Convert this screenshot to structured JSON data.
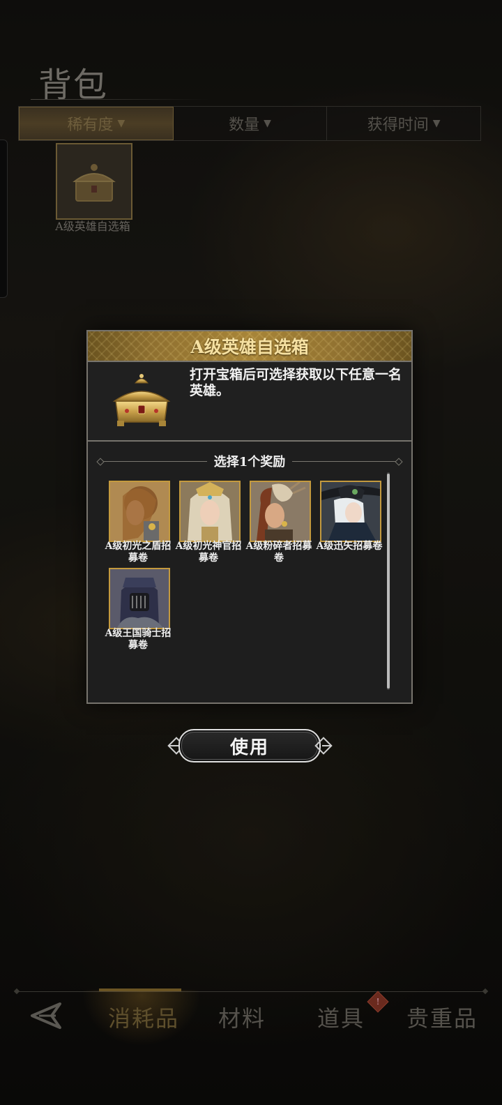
{
  "background": {
    "page_title": "背包",
    "sort_tabs": [
      {
        "label": "稀有度",
        "arrow": "▼",
        "active": true
      },
      {
        "label": "数量",
        "arrow": "▼",
        "active": false
      },
      {
        "label": "获得时间",
        "arrow": "▼",
        "active": false
      }
    ],
    "items": [
      {
        "label": "A级英雄自选箱",
        "icon": "treasure-chest-icon"
      }
    ]
  },
  "bottom_nav": {
    "back_icon": "back-arrow-icon",
    "tabs": [
      {
        "label": "消耗品",
        "active": true
      },
      {
        "label": "材料",
        "active": false
      },
      {
        "label": "道具",
        "active": false,
        "badge": "!"
      },
      {
        "label": "贵重品",
        "active": false
      }
    ]
  },
  "dialog": {
    "title": "A级英雄自选箱",
    "description": "打开宝箱后可选择获取以下任意一名英雄。",
    "chest_icon": "golden-chest-icon",
    "select_title": "选择1个奖励",
    "rewards": [
      {
        "label": "A级初光之盾招募卷",
        "portrait": "hero-portrait-shield"
      },
      {
        "label": "A级初光神官招募卷",
        "portrait": "hero-portrait-priest"
      },
      {
        "label": "A级粉碎者招募卷",
        "portrait": "hero-portrait-crusher"
      },
      {
        "label": "A级迅矢招募卷",
        "portrait": "hero-portrait-archer"
      },
      {
        "label": "A级王国骑士招募卷",
        "portrait": "hero-portrait-knight"
      }
    ],
    "use_button": "使用"
  },
  "colors": {
    "gold": "#c49a3e",
    "header_gold": "#a88538",
    "title_text": "#f6e1a2",
    "panel": "#1f1f1f",
    "border": "#77746d"
  }
}
